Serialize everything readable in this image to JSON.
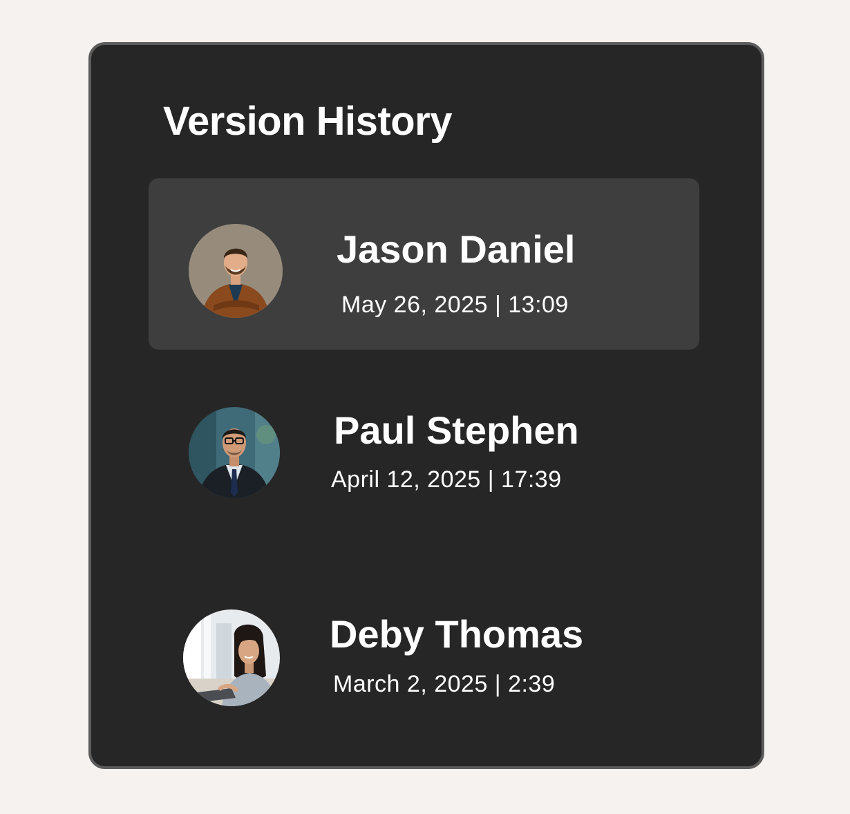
{
  "panel": {
    "title": "Version History"
  },
  "versions": [
    {
      "name": "Jason Daniel",
      "timestamp": "May 26, 2025 | 13:09",
      "selected": true,
      "avatar": "avatar-photo-man-brown-jacket"
    },
    {
      "name": "Paul Stephen",
      "timestamp": "April 12, 2025 | 17:39",
      "selected": false,
      "avatar": "avatar-photo-man-suit-glasses"
    },
    {
      "name": "Deby Thomas",
      "timestamp": "March 2, 2025 | 2:39",
      "selected": false,
      "avatar": "avatar-photo-woman-laptop"
    }
  ],
  "colors": {
    "page_background": "#f5f2ef",
    "panel_background": "#262626",
    "panel_border": "#5c5c5c",
    "selected_row": "#3e3e3e",
    "text": "#ffffff"
  }
}
